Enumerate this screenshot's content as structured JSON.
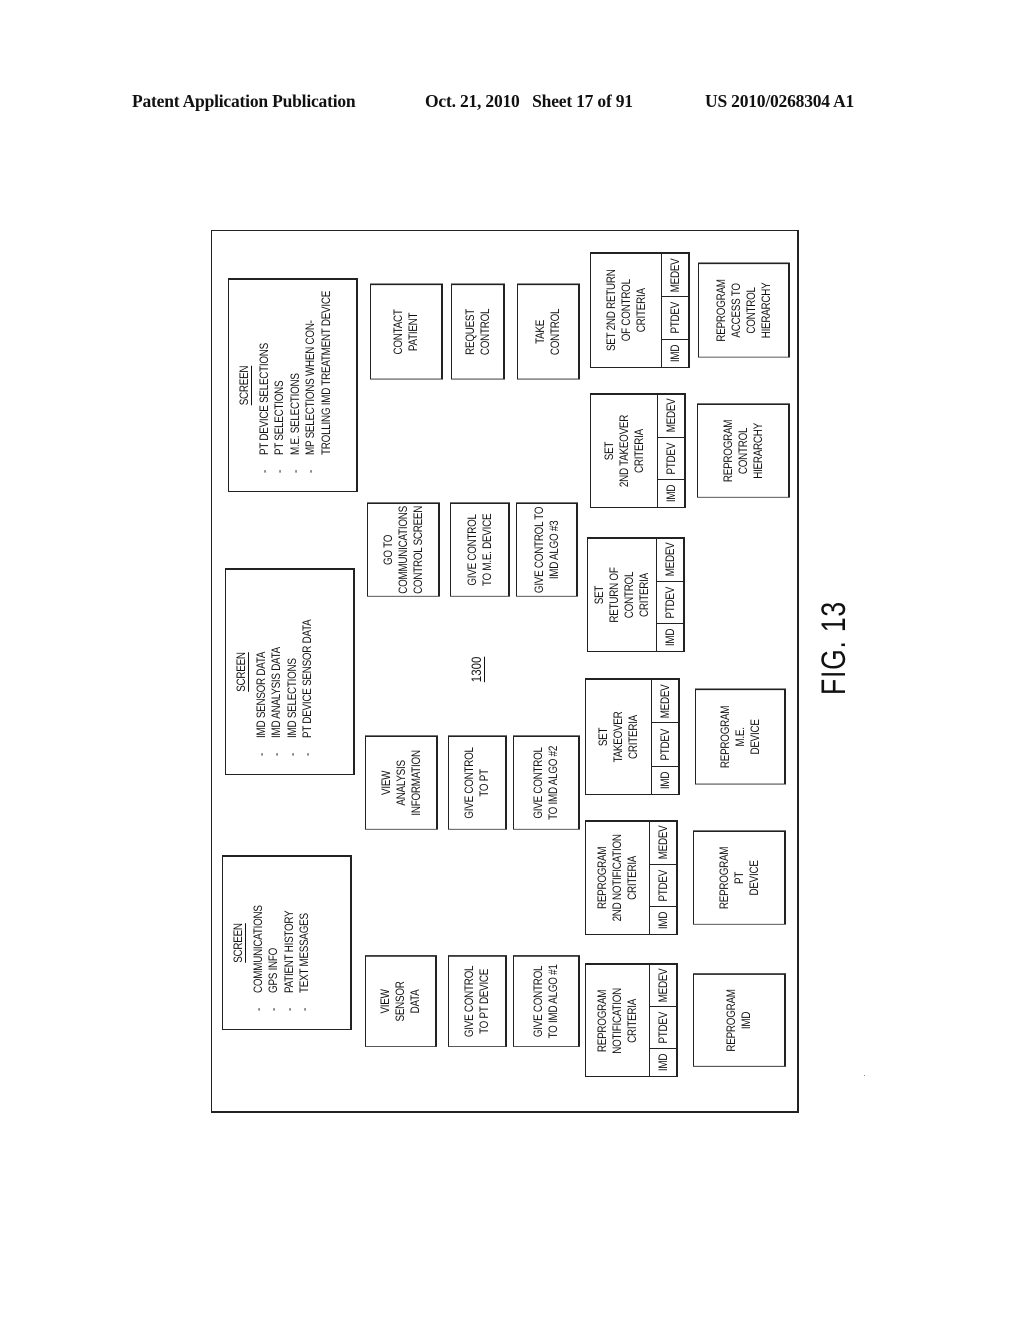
{
  "header": {
    "publication": "Patent Application Publication",
    "date_sheet": "Oct. 21, 2010   Sheet 17 of 91",
    "patent_number": "US 2010/0268304 A1"
  },
  "figure": {
    "reference_number": "1300",
    "label": "FIG. 13"
  },
  "screens": [
    {
      "title": "SCREEN",
      "items": [
        "COMMUNICATIONS",
        "GPS INFO",
        "PATIENT HISTORY",
        "TEXT MESSAGES"
      ]
    },
    {
      "title": "SCREEN",
      "items": [
        "IMD SENSOR DATA",
        "IMD ANALYSIS DATA",
        "IMD SELECTIONS",
        "PT DEVICE SENSOR DATA"
      ]
    },
    {
      "title": "SCREEN",
      "items": [
        "PT DEVICE SELECTIONS",
        "PT SELECTIONS",
        "M.E. SELECTIONS",
        "MP SELECTIONS WHEN CON-"
      ],
      "continuation": "TROLLING  IMD TREATMENT DEVICE"
    }
  ],
  "buttons": {
    "view_sensor_data": "VIEW\nSENSOR\nDATA",
    "give_control_pt_device": "GIVE CONTROL\nTO PT DEVICE",
    "give_control_imd_algo_1": "GIVE CONTROL\nTO IMD  ALGO #1",
    "view_analysis_information": "VIEW\nANALYSIS\nINFORMATION",
    "give_control_pt": "GIVE CONTROL\nTO PT",
    "give_control_imd_algo_2": "GIVE CONTROL\nTO IMD ALGO #2",
    "go_to_communications": "GO TO\nCOMMUNICATIONS\nCONTROL  SCREEN",
    "give_control_me_device": "GIVE CONTROL\nTO M.E. DEVICE",
    "give_control_imd_algo_3": "GIVE CONTROL TO\nIMD ALGO #3",
    "contact_patient": "CONTACT\nPATIENT",
    "request_control": "REQUEST\nCONTROL",
    "take_control": "TAKE\nCONTROL",
    "reprogram_imd": "REPROGRAM\nIMD",
    "reprogram_pt_device": "REPROGRAM\nPT\nDEVICE",
    "reprogram_me_device": "REPROGRAM\nM.E.\nDEVICE",
    "reprogram_control_hierarchy": "REPROGRAM\nCONTROL\nHIERARCHY",
    "reprogram_access_control_hierarchy": "REPROGRAM\nACCESS TO\nCONTROL\nHIERARCHY"
  },
  "criteria": [
    {
      "label": "REPROGRAM\nNOTIFICATION\nCRITERIA",
      "options": [
        "IMD",
        "PTDEV",
        "MEDEV"
      ]
    },
    {
      "label": "REPROGRAM\n2ND NOTIFICATION\nCRITERIA",
      "options": [
        "IMD",
        "PTDEV",
        "MEDEV"
      ]
    },
    {
      "label": "SET\nTAKEOVER\nCRITERIA",
      "options": [
        "IMD",
        "PTDEV",
        "MEDEV"
      ]
    },
    {
      "label": "SET\nRETURN OF CONTROL\nCRITERIA",
      "options": [
        "IMD",
        "PTDEV",
        "MEDEV"
      ]
    },
    {
      "label": "SET\n2ND TAKEOVER\nCRITERIA",
      "options": [
        "IMD",
        "PTDEV",
        "MEDEV"
      ]
    },
    {
      "label": "SET 2ND RETURN\nOF CONTROL\nCRITERIA",
      "options": [
        "IMD",
        "PTDEV",
        "MEDEV"
      ]
    }
  ]
}
